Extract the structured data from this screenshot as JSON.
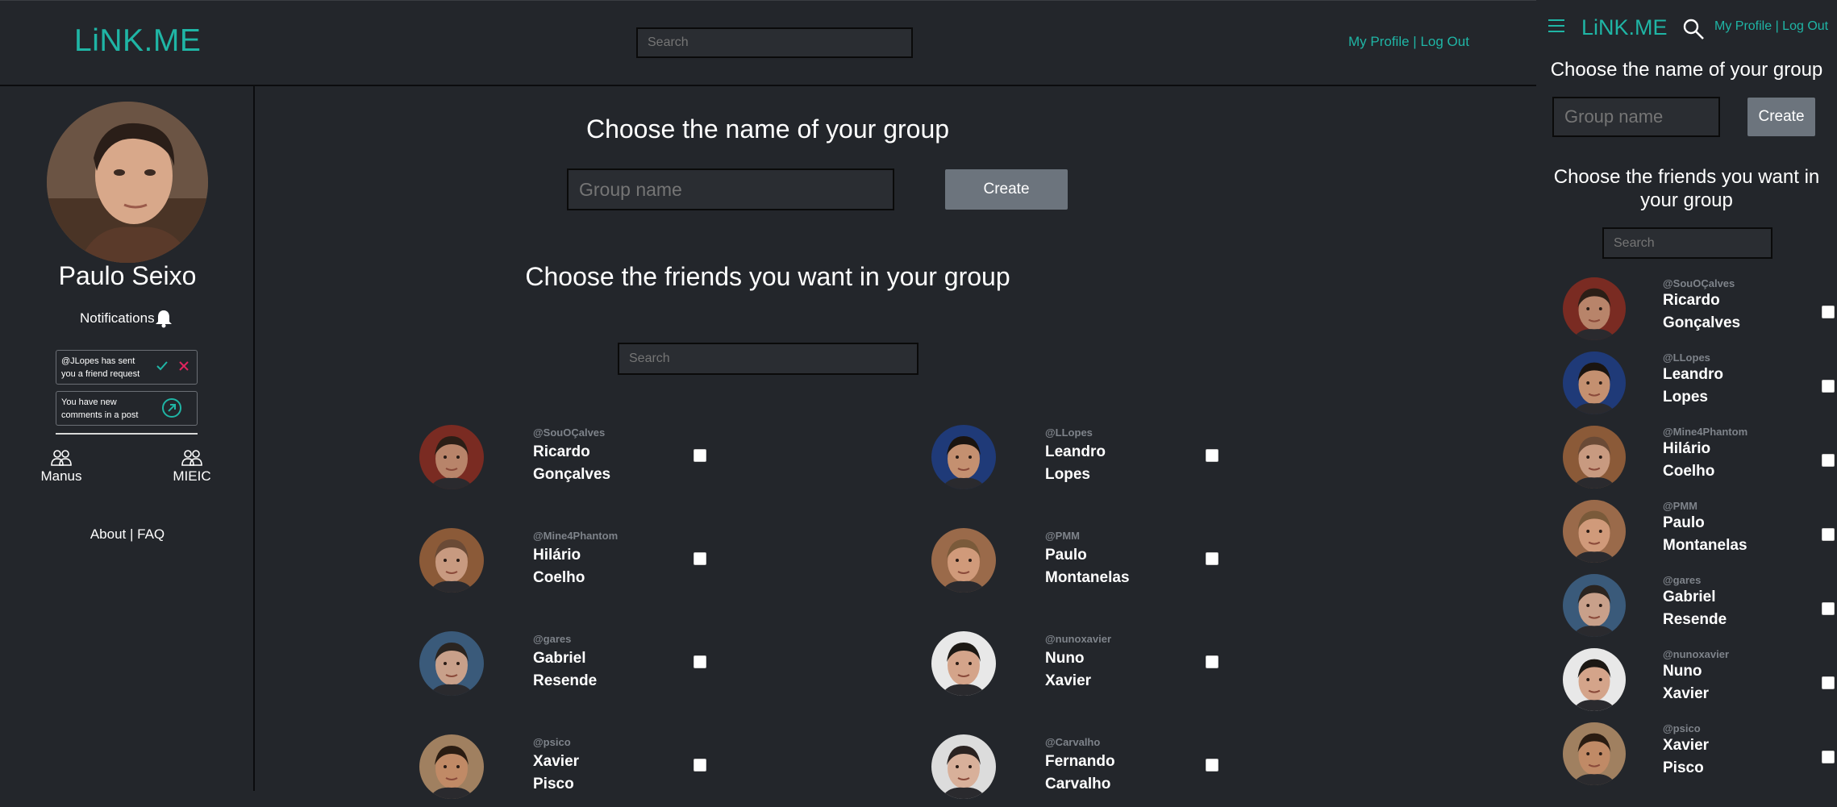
{
  "brand": "LiNK.ME",
  "header": {
    "search_placeholder": "Search",
    "profile_link": "My Profile",
    "separator": " | ",
    "logout_link": "Log Out"
  },
  "sidebar": {
    "user_name": "Paulo Seixo",
    "notifications_label": "Notifications",
    "notifications": [
      {
        "text": "@JLopes has sent you a friend request",
        "type": "friend-request"
      },
      {
        "text": "You have new comments in a post",
        "type": "post-comment"
      }
    ],
    "groups": [
      {
        "label": "Manus"
      },
      {
        "label": "MIEIC"
      }
    ],
    "about_link": "About",
    "faq_link": "FAQ",
    "footer_separator": " | "
  },
  "main": {
    "group_name_title": "Choose the name of your group",
    "group_name_placeholder": "Group name",
    "create_label": "Create",
    "friends_title": "Choose the friends you want in your group",
    "friend_search_placeholder": "Search"
  },
  "friends": [
    {
      "handle": "@SouOÇalves",
      "first": "Ricardo",
      "last": "Gonçalves",
      "skin": "#b8846a",
      "hair": "#2b1e16",
      "bg": "#7a2b22"
    },
    {
      "handle": "@LLopes",
      "first": "Leandro",
      "last": "Lopes",
      "skin": "#c49070",
      "hair": "#1a1410",
      "bg": "#1f3a78"
    },
    {
      "handle": "@Mine4Phantom",
      "first": "Hilário",
      "last": "Coelho",
      "skin": "#c89a80",
      "hair": "#6a4a36",
      "bg": "#8b5a38"
    },
    {
      "handle": "@PMM",
      "first": "Paulo",
      "last": "Montanelas",
      "skin": "#d09a7a",
      "hair": "#7a5a3a",
      "bg": "#9a6a4a"
    },
    {
      "handle": "@gares",
      "first": "Gabriel",
      "last": "Resende",
      "skin": "#c8a08a",
      "hair": "#2a2420",
      "bg": "#3a5a7a"
    },
    {
      "handle": "@nunoxavier",
      "first": "Nuno",
      "last": "Xavier",
      "skin": "#d4a48a",
      "hair": "#1c1814",
      "bg": "#e8e8e8"
    },
    {
      "handle": "@psico",
      "first": "Xavier",
      "last": "Pisco",
      "skin": "#c08a66",
      "hair": "#2a1c12",
      "bg": "#a08060"
    },
    {
      "handle": "@Carvalho",
      "first": "Fernando",
      "last": "Carvalho",
      "skin": "#d8b09a",
      "hair": "#2a2220",
      "bg": "#dcdcdc"
    }
  ],
  "colors": {
    "accent": "#1fb5a5",
    "background": "#23262b",
    "button": "#6c747d",
    "decline": "#e0245e"
  }
}
